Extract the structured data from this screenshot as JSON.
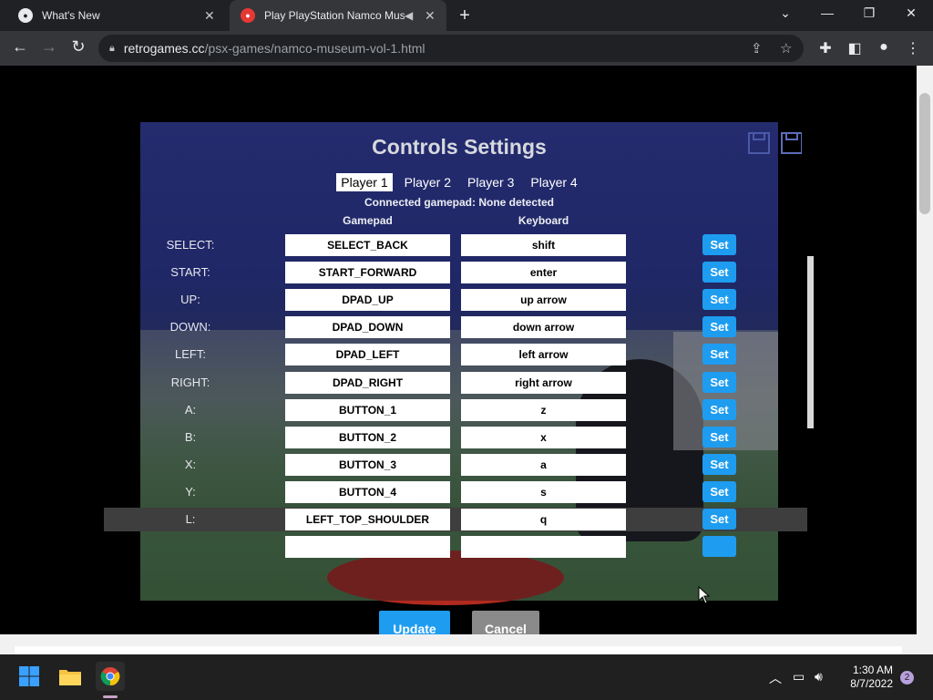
{
  "browser": {
    "tabs": [
      {
        "title": "What's New",
        "active": false
      },
      {
        "title": "Play PlayStation Namco Mus",
        "active": true
      }
    ],
    "url_host": "retrogames.cc",
    "url_path": "/psx-games/namco-museum-vol-1.html"
  },
  "controls": {
    "title": "Controls Settings",
    "players": [
      "Player 1",
      "Player 2",
      "Player 3",
      "Player 4"
    ],
    "active_player": "Player 1",
    "gamepad_status": "Connected gamepad: None detected",
    "col_gamepad": "Gamepad",
    "col_keyboard": "Keyboard",
    "set_label": "Set",
    "rows": [
      {
        "label": "SELECT:",
        "gamepad": "SELECT_BACK",
        "keyboard": "shift"
      },
      {
        "label": "START:",
        "gamepad": "START_FORWARD",
        "keyboard": "enter"
      },
      {
        "label": "UP:",
        "gamepad": "DPAD_UP",
        "keyboard": "up arrow"
      },
      {
        "label": "DOWN:",
        "gamepad": "DPAD_DOWN",
        "keyboard": "down arrow"
      },
      {
        "label": "LEFT:",
        "gamepad": "DPAD_LEFT",
        "keyboard": "left arrow"
      },
      {
        "label": "RIGHT:",
        "gamepad": "DPAD_RIGHT",
        "keyboard": "right arrow"
      },
      {
        "label": "A:",
        "gamepad": "BUTTON_1",
        "keyboard": "z"
      },
      {
        "label": "B:",
        "gamepad": "BUTTON_2",
        "keyboard": "x"
      },
      {
        "label": "X:",
        "gamepad": "BUTTON_3",
        "keyboard": "a"
      },
      {
        "label": "Y:",
        "gamepad": "BUTTON_4",
        "keyboard": "s"
      },
      {
        "label": "L:",
        "gamepad": "LEFT_TOP_SHOULDER",
        "keyboard": "q"
      }
    ],
    "highlighted_row": "L:",
    "update_label": "Update",
    "cancel_label": "Cancel"
  },
  "taskbar": {
    "time": "1:30 AM",
    "date": "8/7/2022",
    "notifications": "2"
  },
  "colors": {
    "accent": "#1e9cf0",
    "cancel": "#8a8a8a",
    "chrome_dark": "#202124",
    "chrome_toolbar": "#35363a"
  }
}
